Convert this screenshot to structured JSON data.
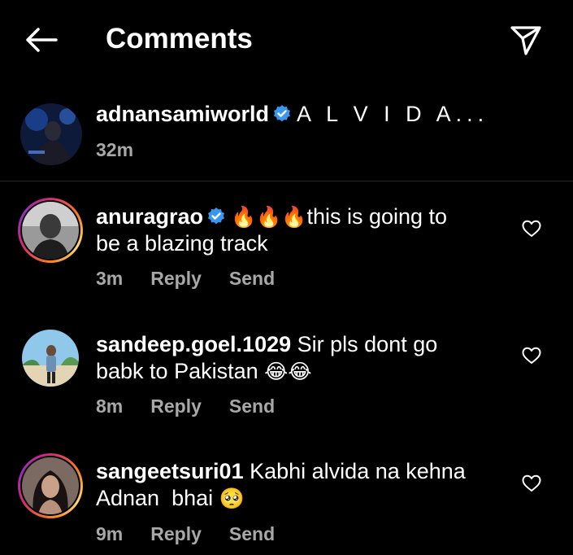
{
  "header": {
    "title": "Comments"
  },
  "caption": {
    "username": "adnansamiworld",
    "text": "A L V I D A...",
    "time": "32m"
  },
  "comments": [
    {
      "username": "anuragrao",
      "verified": true,
      "emoji_prefix": "🔥🔥🔥",
      "text_line1": "this is going to",
      "text_line2": "be a blazing track",
      "time": "3m",
      "reply": "Reply",
      "send": "Send"
    },
    {
      "username": "sandeep.goel.1029",
      "text_line1": "Sir pls dont go",
      "text_line2": "babk to Pakistan",
      "emoji_suffix": "😂😂",
      "time": "8m",
      "reply": "Reply",
      "send": "Send"
    },
    {
      "username": "sangeetsuri01",
      "text_line1": "Kabhi alvida na kehna",
      "text_line2": "Adnan  bhai",
      "emoji_suffix": "🥺",
      "time": "9m",
      "reply": "Reply",
      "send": "Send"
    }
  ],
  "colors": {
    "background": "#000000",
    "secondary_text": "#a8a8a8",
    "verified": "#3897f0"
  },
  "icons": [
    "back-arrow-icon",
    "direct-send-icon",
    "verified-badge-icon",
    "heart-icon"
  ]
}
